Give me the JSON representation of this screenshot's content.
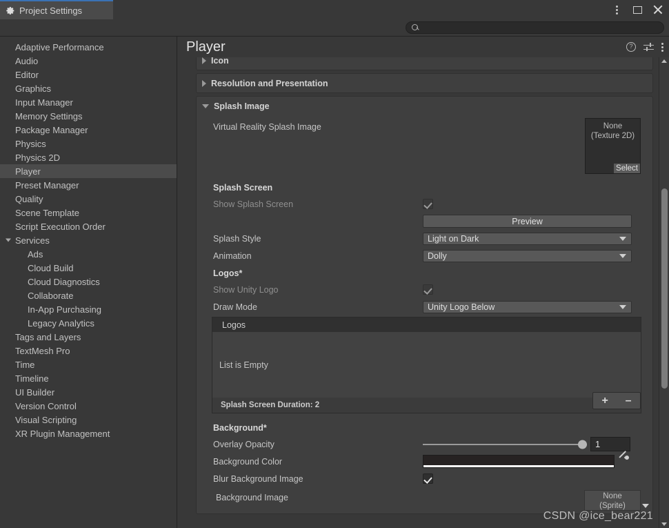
{
  "window": {
    "tab_label": "Project Settings",
    "tab_icon": "gear-icon",
    "menu_icon": "kebab-menu-icon",
    "maximize_icon": "maximize-icon",
    "close_icon": "close-icon"
  },
  "search": {
    "value": "",
    "placeholder": "",
    "icon": "search-icon"
  },
  "sidebar": {
    "items": [
      {
        "label": "Adaptive Performance",
        "level": 0,
        "selected": false,
        "expander": ""
      },
      {
        "label": "Audio",
        "level": 0,
        "selected": false,
        "expander": ""
      },
      {
        "label": "Editor",
        "level": 0,
        "selected": false,
        "expander": ""
      },
      {
        "label": "Graphics",
        "level": 0,
        "selected": false,
        "expander": ""
      },
      {
        "label": "Input Manager",
        "level": 0,
        "selected": false,
        "expander": ""
      },
      {
        "label": "Memory Settings",
        "level": 0,
        "selected": false,
        "expander": ""
      },
      {
        "label": "Package Manager",
        "level": 0,
        "selected": false,
        "expander": ""
      },
      {
        "label": "Physics",
        "level": 0,
        "selected": false,
        "expander": ""
      },
      {
        "label": "Physics 2D",
        "level": 0,
        "selected": false,
        "expander": ""
      },
      {
        "label": "Player",
        "level": 0,
        "selected": true,
        "expander": ""
      },
      {
        "label": "Preset Manager",
        "level": 0,
        "selected": false,
        "expander": ""
      },
      {
        "label": "Quality",
        "level": 0,
        "selected": false,
        "expander": ""
      },
      {
        "label": "Scene Template",
        "level": 0,
        "selected": false,
        "expander": ""
      },
      {
        "label": "Script Execution Order",
        "level": 0,
        "selected": false,
        "expander": ""
      },
      {
        "label": "Services",
        "level": 0,
        "selected": false,
        "expander": "down"
      },
      {
        "label": "Ads",
        "level": 1,
        "selected": false,
        "expander": ""
      },
      {
        "label": "Cloud Build",
        "level": 1,
        "selected": false,
        "expander": ""
      },
      {
        "label": "Cloud Diagnostics",
        "level": 1,
        "selected": false,
        "expander": ""
      },
      {
        "label": "Collaborate",
        "level": 1,
        "selected": false,
        "expander": ""
      },
      {
        "label": "In-App Purchasing",
        "level": 1,
        "selected": false,
        "expander": ""
      },
      {
        "label": "Legacy Analytics",
        "level": 1,
        "selected": false,
        "expander": ""
      },
      {
        "label": "Tags and Layers",
        "level": 0,
        "selected": false,
        "expander": ""
      },
      {
        "label": "TextMesh Pro",
        "level": 0,
        "selected": false,
        "expander": ""
      },
      {
        "label": "Time",
        "level": 0,
        "selected": false,
        "expander": ""
      },
      {
        "label": "Timeline",
        "level": 0,
        "selected": false,
        "expander": ""
      },
      {
        "label": "UI Builder",
        "level": 0,
        "selected": false,
        "expander": ""
      },
      {
        "label": "Version Control",
        "level": 0,
        "selected": false,
        "expander": ""
      },
      {
        "label": "Visual Scripting",
        "level": 0,
        "selected": false,
        "expander": ""
      },
      {
        "label": "XR Plugin Management",
        "level": 0,
        "selected": false,
        "expander": ""
      }
    ]
  },
  "main": {
    "title": "Player",
    "help_icon": "help-icon",
    "help_glyph": "?",
    "preset_icon": "preset-icon",
    "more_icon": "kebab-menu-icon"
  },
  "sections": {
    "icon": {
      "title": "Icon",
      "expanded": false
    },
    "resolution": {
      "title": "Resolution and Presentation",
      "expanded": false
    },
    "splash": {
      "title": "Splash Image",
      "expanded": true
    }
  },
  "splash_image": {
    "vr_splash_label": "Virtual Reality Splash Image",
    "vr_splash_value_line1": "None",
    "vr_splash_value_line2": "(Texture 2D)",
    "vr_splash_select": "Select",
    "splash_screen_group": "Splash Screen",
    "show_splash_screen_label": "Show Splash Screen",
    "show_splash_screen_checked": true,
    "preview_button": "Preview",
    "splash_style_label": "Splash Style",
    "splash_style_value": "Light on Dark",
    "animation_label": "Animation",
    "animation_value": "Dolly",
    "logos_group": "Logos*",
    "show_unity_logo_label": "Show Unity Logo",
    "show_unity_logo_checked": true,
    "draw_mode_label": "Draw Mode",
    "draw_mode_value": "Unity Logo Below",
    "logos_list_header": "Logos",
    "logos_list_empty": "List is Empty",
    "splash_duration": "Splash Screen Duration: 2",
    "add_button": "+",
    "remove_button": "–",
    "background_group": "Background*",
    "overlay_opacity_label": "Overlay Opacity",
    "overlay_opacity_value": "1",
    "background_color_label": "Background Color",
    "background_color_hex": "#262222",
    "eyedropper_icon": "eyedropper-icon",
    "blur_background_label": "Blur Background Image",
    "blur_background_checked": true,
    "background_image_label": "Background Image",
    "background_image_value_line1": "None",
    "background_image_value_line2": "(Sprite)"
  },
  "watermark": {
    "text": "CSDN @ice_bear221"
  }
}
